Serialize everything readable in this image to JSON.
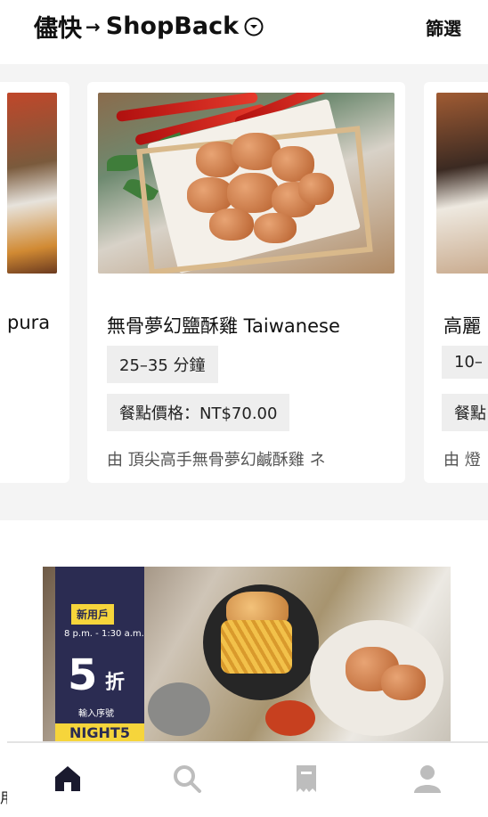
{
  "header": {
    "brand_left": "儘快",
    "arrow": "→",
    "brand_right": "ShopBack",
    "filter_label": "篩選"
  },
  "carousel": {
    "left_card": {
      "name_partial": "pura"
    },
    "main_card": {
      "name": "無骨夢幻鹽酥雞 Taiwanese",
      "delivery_time": "25–35 分鐘",
      "price": "餐點價格：NT$70.00",
      "description": "由 頂尖高手無骨夢幻鹹酥雞 ネ"
    },
    "right_card": {
      "name_partial": "高麗",
      "delivery_time_partial": "10–",
      "price_partial": "餐點",
      "description_partial": "由 燈"
    }
  },
  "banner": {
    "badge": "新用戶",
    "time": "8 p.m. - 1:30 a.m.",
    "discount_number": "5",
    "discount_unit": "折",
    "sub": "輸入序號",
    "code": "NIGHT5"
  },
  "edge_char": "用",
  "colors": {
    "nav_active": "#1a1a2e",
    "nav_inactive": "#bdbdbd",
    "promo_bg": "#2b2c52",
    "promo_accent": "#f6d53b"
  },
  "nav": {
    "items": [
      "home-icon",
      "search-icon",
      "orders-icon",
      "account-icon"
    ],
    "active": "home-icon"
  }
}
